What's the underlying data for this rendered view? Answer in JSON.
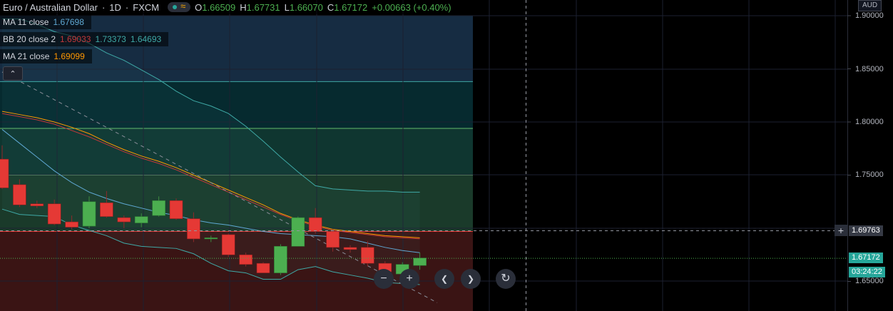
{
  "header": {
    "symbol_name": "Euro / Australian Dollar",
    "interval": "1D",
    "exchange": "FXCM",
    "open_label": "O",
    "open": "1.66509",
    "high_label": "H",
    "high": "1.67731",
    "low_label": "L",
    "low": "1.66070",
    "close_label": "C",
    "close": "1.67172",
    "change": "+0.00663 (+0.40%)"
  },
  "indicators": [
    {
      "label": "MA 11 close",
      "values": [
        "1.67698"
      ],
      "colors": [
        "#5fa8d3"
      ]
    },
    {
      "label": "BB 20 close 2",
      "values": [
        "1.69033",
        "1.73373",
        "1.64693"
      ],
      "colors": [
        "#c2383a",
        "#3fa9a6",
        "#3fa9a6"
      ]
    },
    {
      "label": "MA 21 close",
      "values": [
        "1.69099"
      ],
      "colors": [
        "#ff9800"
      ]
    }
  ],
  "price_axis": {
    "currency": "AUD",
    "labels": [
      "1.90000",
      "1.85000",
      "1.80000",
      "1.75000",
      "1.65000"
    ],
    "crosshair_price": "1.69763",
    "last_price": "1.67172",
    "countdown": "03:24:22"
  },
  "colors": {
    "up": "#4caf50",
    "down": "#e53935",
    "ma11": "#5fa8d3",
    "ma21": "#ff9800",
    "bb_basis": "#c2383a",
    "bb_band": "#3fa9a6"
  },
  "chart_data": {
    "type": "candlestick",
    "symbol": "EURAUD",
    "interval": "1D",
    "ylim": [
      1.628,
      1.915
    ],
    "candles": [
      {
        "o": 1.765,
        "h": 1.778,
        "l": 1.737,
        "c": 1.738
      },
      {
        "o": 1.741,
        "h": 1.746,
        "l": 1.72,
        "c": 1.722
      },
      {
        "o": 1.723,
        "h": 1.726,
        "l": 1.719,
        "c": 1.721
      },
      {
        "o": 1.723,
        "h": 1.727,
        "l": 1.703,
        "c": 1.704
      },
      {
        "o": 1.706,
        "h": 1.712,
        "l": 1.699,
        "c": 1.701
      },
      {
        "o": 1.702,
        "h": 1.73,
        "l": 1.7,
        "c": 1.725
      },
      {
        "o": 1.724,
        "h": 1.735,
        "l": 1.71,
        "c": 1.711
      },
      {
        "o": 1.71,
        "h": 1.712,
        "l": 1.7,
        "c": 1.706
      },
      {
        "o": 1.705,
        "h": 1.714,
        "l": 1.701,
        "c": 1.711
      },
      {
        "o": 1.712,
        "h": 1.73,
        "l": 1.711,
        "c": 1.726
      },
      {
        "o": 1.726,
        "h": 1.728,
        "l": 1.708,
        "c": 1.709
      },
      {
        "o": 1.709,
        "h": 1.715,
        "l": 1.687,
        "c": 1.69
      },
      {
        "o": 1.69,
        "h": 1.693,
        "l": 1.687,
        "c": 1.691
      },
      {
        "o": 1.694,
        "h": 1.695,
        "l": 1.673,
        "c": 1.675
      },
      {
        "o": 1.675,
        "h": 1.677,
        "l": 1.664,
        "c": 1.666
      },
      {
        "o": 1.667,
        "h": 1.668,
        "l": 1.658,
        "c": 1.658
      },
      {
        "o": 1.658,
        "h": 1.685,
        "l": 1.656,
        "c": 1.683
      },
      {
        "o": 1.683,
        "h": 1.711,
        "l": 1.683,
        "c": 1.71
      },
      {
        "o": 1.71,
        "h": 1.719,
        "l": 1.695,
        "c": 1.697
      },
      {
        "o": 1.697,
        "h": 1.699,
        "l": 1.678,
        "c": 1.682
      },
      {
        "o": 1.682,
        "h": 1.684,
        "l": 1.677,
        "c": 1.68
      },
      {
        "o": 1.682,
        "h": 1.688,
        "l": 1.664,
        "c": 1.667
      },
      {
        "o": 1.667,
        "h": 1.669,
        "l": 1.657,
        "c": 1.659
      },
      {
        "o": 1.657,
        "h": 1.668,
        "l": 1.656,
        "c": 1.666
      },
      {
        "o": 1.665,
        "h": 1.677,
        "l": 1.661,
        "c": 1.672
      }
    ],
    "ma11": [
      1.793,
      1.78,
      1.767,
      1.754,
      1.743,
      1.734,
      1.728,
      1.723,
      1.719,
      1.715,
      1.712,
      1.708,
      1.705,
      1.703,
      1.7,
      1.697,
      1.695,
      1.694,
      1.693,
      1.692,
      1.69,
      1.686,
      1.682,
      1.679,
      1.677
    ],
    "ma21": [
      1.81,
      1.807,
      1.804,
      1.8,
      1.795,
      1.789,
      1.781,
      1.774,
      1.768,
      1.763,
      1.757,
      1.75,
      1.743,
      1.736,
      1.729,
      1.722,
      1.714,
      1.708,
      1.703,
      1.699,
      1.697,
      1.695,
      1.693,
      1.692,
      1.691
    ],
    "bb_basis": [
      1.808,
      1.805,
      1.802,
      1.798,
      1.792,
      1.786,
      1.779,
      1.772,
      1.766,
      1.761,
      1.755,
      1.748,
      1.741,
      1.734,
      1.727,
      1.72,
      1.713,
      1.707,
      1.702,
      1.698,
      1.696,
      1.694,
      1.692,
      1.691,
      1.69
    ],
    "bb_upper": [
      1.897,
      1.897,
      1.892,
      1.885,
      1.881,
      1.874,
      1.865,
      1.858,
      1.849,
      1.84,
      1.829,
      1.82,
      1.815,
      1.808,
      1.796,
      1.782,
      1.767,
      1.753,
      1.74,
      1.737,
      1.736,
      1.735,
      1.735,
      1.734,
      1.734
    ],
    "bb_lower": [
      1.718,
      1.713,
      1.712,
      1.711,
      1.703,
      1.698,
      1.693,
      1.686,
      1.683,
      1.682,
      1.681,
      1.676,
      1.667,
      1.66,
      1.658,
      1.652,
      1.652,
      1.661,
      1.664,
      1.659,
      1.656,
      1.653,
      1.649,
      1.648,
      1.647
    ],
    "fib_levels": [
      {
        "price": 1.9,
        "band_color": "#162c42"
      },
      {
        "price": 1.838,
        "band_color": "#062a2f"
      },
      {
        "price": 1.794,
        "band_color": "#0f3630"
      },
      {
        "price": 1.75,
        "band_color": "#1a3a2a"
      },
      {
        "price": 1.697,
        "band_color": "#3a1414"
      }
    ],
    "trendline": {
      "from": [
        0,
        1.847
      ],
      "to": [
        25,
        1.63
      ]
    },
    "crosshair_price": 1.69763,
    "last_price": 1.67172,
    "y_ticks": [
      1.9,
      1.85,
      1.8,
      1.75,
      1.65
    ]
  },
  "controls": {
    "collapse": "⌃",
    "zoom_out": "−",
    "zoom_in": "+",
    "scroll_left": "❮",
    "scroll_right": "❯",
    "reset": "↻",
    "crosshair_add": "+"
  }
}
